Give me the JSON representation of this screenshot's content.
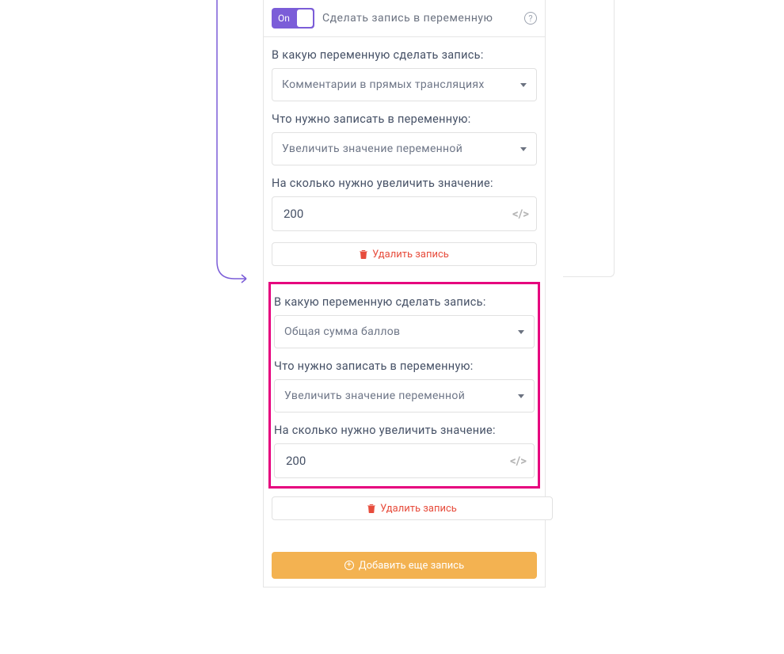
{
  "header": {
    "toggle_label": "On",
    "title": "Сделать запись в переменную"
  },
  "labels": {
    "var_select": "В какую переменную сделать запись:",
    "action_select": "Что нужно записать в переменную:",
    "value_input": "На сколько нужно увеличить значение:"
  },
  "records": [
    {
      "variable": "Комментарии в прямых трансляциях",
      "action": "Увеличить значение переменной",
      "value": "200"
    },
    {
      "variable": "Общая сумма баллов",
      "action": "Увеличить значение переменной",
      "value": "200"
    }
  ],
  "buttons": {
    "delete": "Удалить запись",
    "add": "Добавить еще запись"
  },
  "colors": {
    "accent": "#7b5dd8",
    "highlight": "#e6007e",
    "warning": "#f3b251",
    "danger": "#e74c3c"
  }
}
